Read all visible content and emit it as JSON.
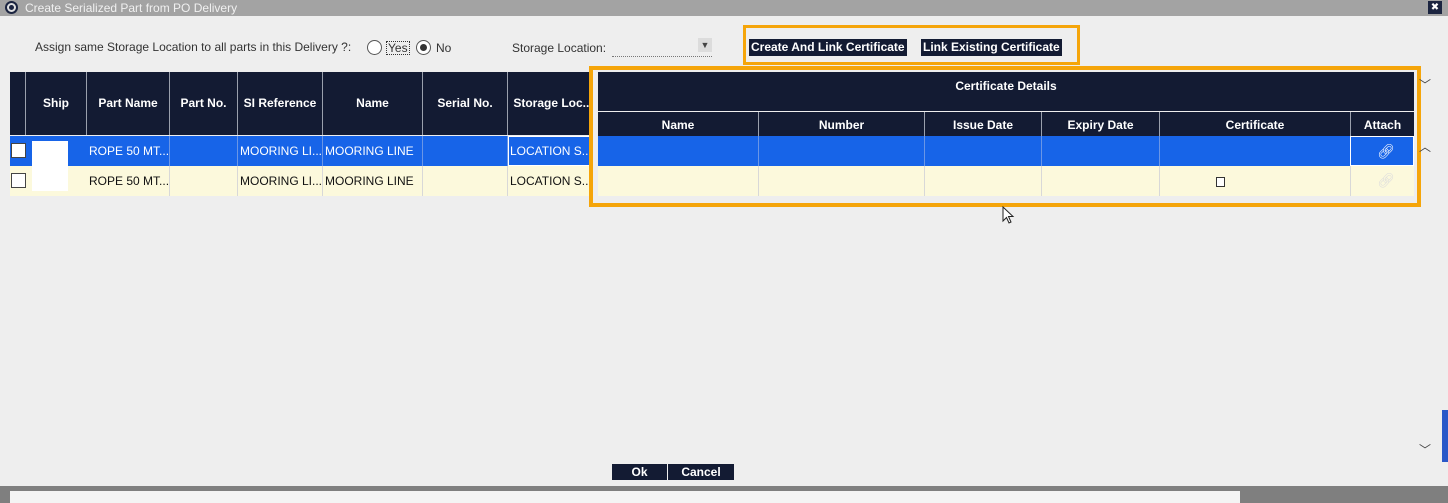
{
  "window": {
    "title": "Create Serialized Part from PO Delivery",
    "close_label": "✖"
  },
  "options": {
    "assign_label": "Assign same Storage Location to all parts in this Delivery ?:",
    "yes_label": "Yes",
    "no_label": "No",
    "selected": "No",
    "storage_label": "Storage Location:",
    "storage_value": ""
  },
  "actions": {
    "create_link": "Create And Link Certificate",
    "link_existing": "Link Existing Certificate"
  },
  "grid": {
    "columns": [
      "Ship",
      "Part Name",
      "Part No.",
      "SI Reference",
      "Name",
      "Serial No.",
      "Storage Loc..."
    ],
    "rows": [
      {
        "ship": "",
        "part_name": "ROPE 50 MT...",
        "part_no": "",
        "si_reference": "MOORING LI...",
        "name": "MOORING LINE",
        "serial_no": "",
        "storage_loc": "LOCATION S..."
      },
      {
        "ship": "",
        "part_name": "ROPE 50 MT...",
        "part_no": "",
        "si_reference": "MOORING LI...",
        "name": "MOORING LINE",
        "serial_no": "",
        "storage_loc": "LOCATION S..."
      }
    ]
  },
  "certificate": {
    "title": "Certificate Details",
    "columns": [
      "Name",
      "Number",
      "Issue Date",
      "Expiry Date",
      "Certificate",
      "Attach"
    ],
    "attach_icon": "link-icon",
    "file_icon": "file-icon"
  },
  "footer": {
    "ok": "Ok",
    "cancel": "Cancel"
  },
  "colors": {
    "header": "#131b33",
    "selected_row": "#1764e8",
    "alt_row": "#fcf9dc",
    "highlight": "#f5a50a"
  }
}
